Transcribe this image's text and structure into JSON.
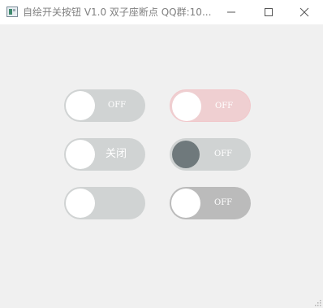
{
  "window": {
    "title": "自绘开关按钮 V1.0 双子座断点 QQ群:10...",
    "icon": "app-window-icon"
  },
  "controls": {
    "minimize_icon": "minimize-icon",
    "maximize_icon": "maximize-icon",
    "close_icon": "close-icon"
  },
  "switches": [
    {
      "id": "switch-1",
      "text": "OFF",
      "checked": false,
      "colors": {
        "track": "#d0d3d3",
        "knob": "#ffffff",
        "text": "#ffffff"
      }
    },
    {
      "id": "switch-2",
      "text": "OFF",
      "checked": false,
      "colors": {
        "track": "#efcfd1",
        "knob": "#ffffff",
        "text": "#ffffff",
        "border": "#f1c8cb"
      }
    },
    {
      "id": "switch-3",
      "text": "关闭",
      "checked": false,
      "colors": {
        "track": "#d0d3d3",
        "knob": "#ffffff",
        "text": "#ffffff"
      }
    },
    {
      "id": "switch-4",
      "text": "OFF",
      "checked": false,
      "colors": {
        "track": "#d0d3d3",
        "knob": "#6f797c",
        "text": "#ffffff"
      }
    },
    {
      "id": "switch-5",
      "text": "",
      "checked": false,
      "colors": {
        "track": "#d0d3d3",
        "knob": "#ffffff",
        "text": "#ffffff"
      }
    },
    {
      "id": "switch-6",
      "text": "OFF",
      "checked": false,
      "colors": {
        "track": "#bbbbbb",
        "knob": "#ffffff",
        "text": "#ffffff"
      }
    }
  ]
}
